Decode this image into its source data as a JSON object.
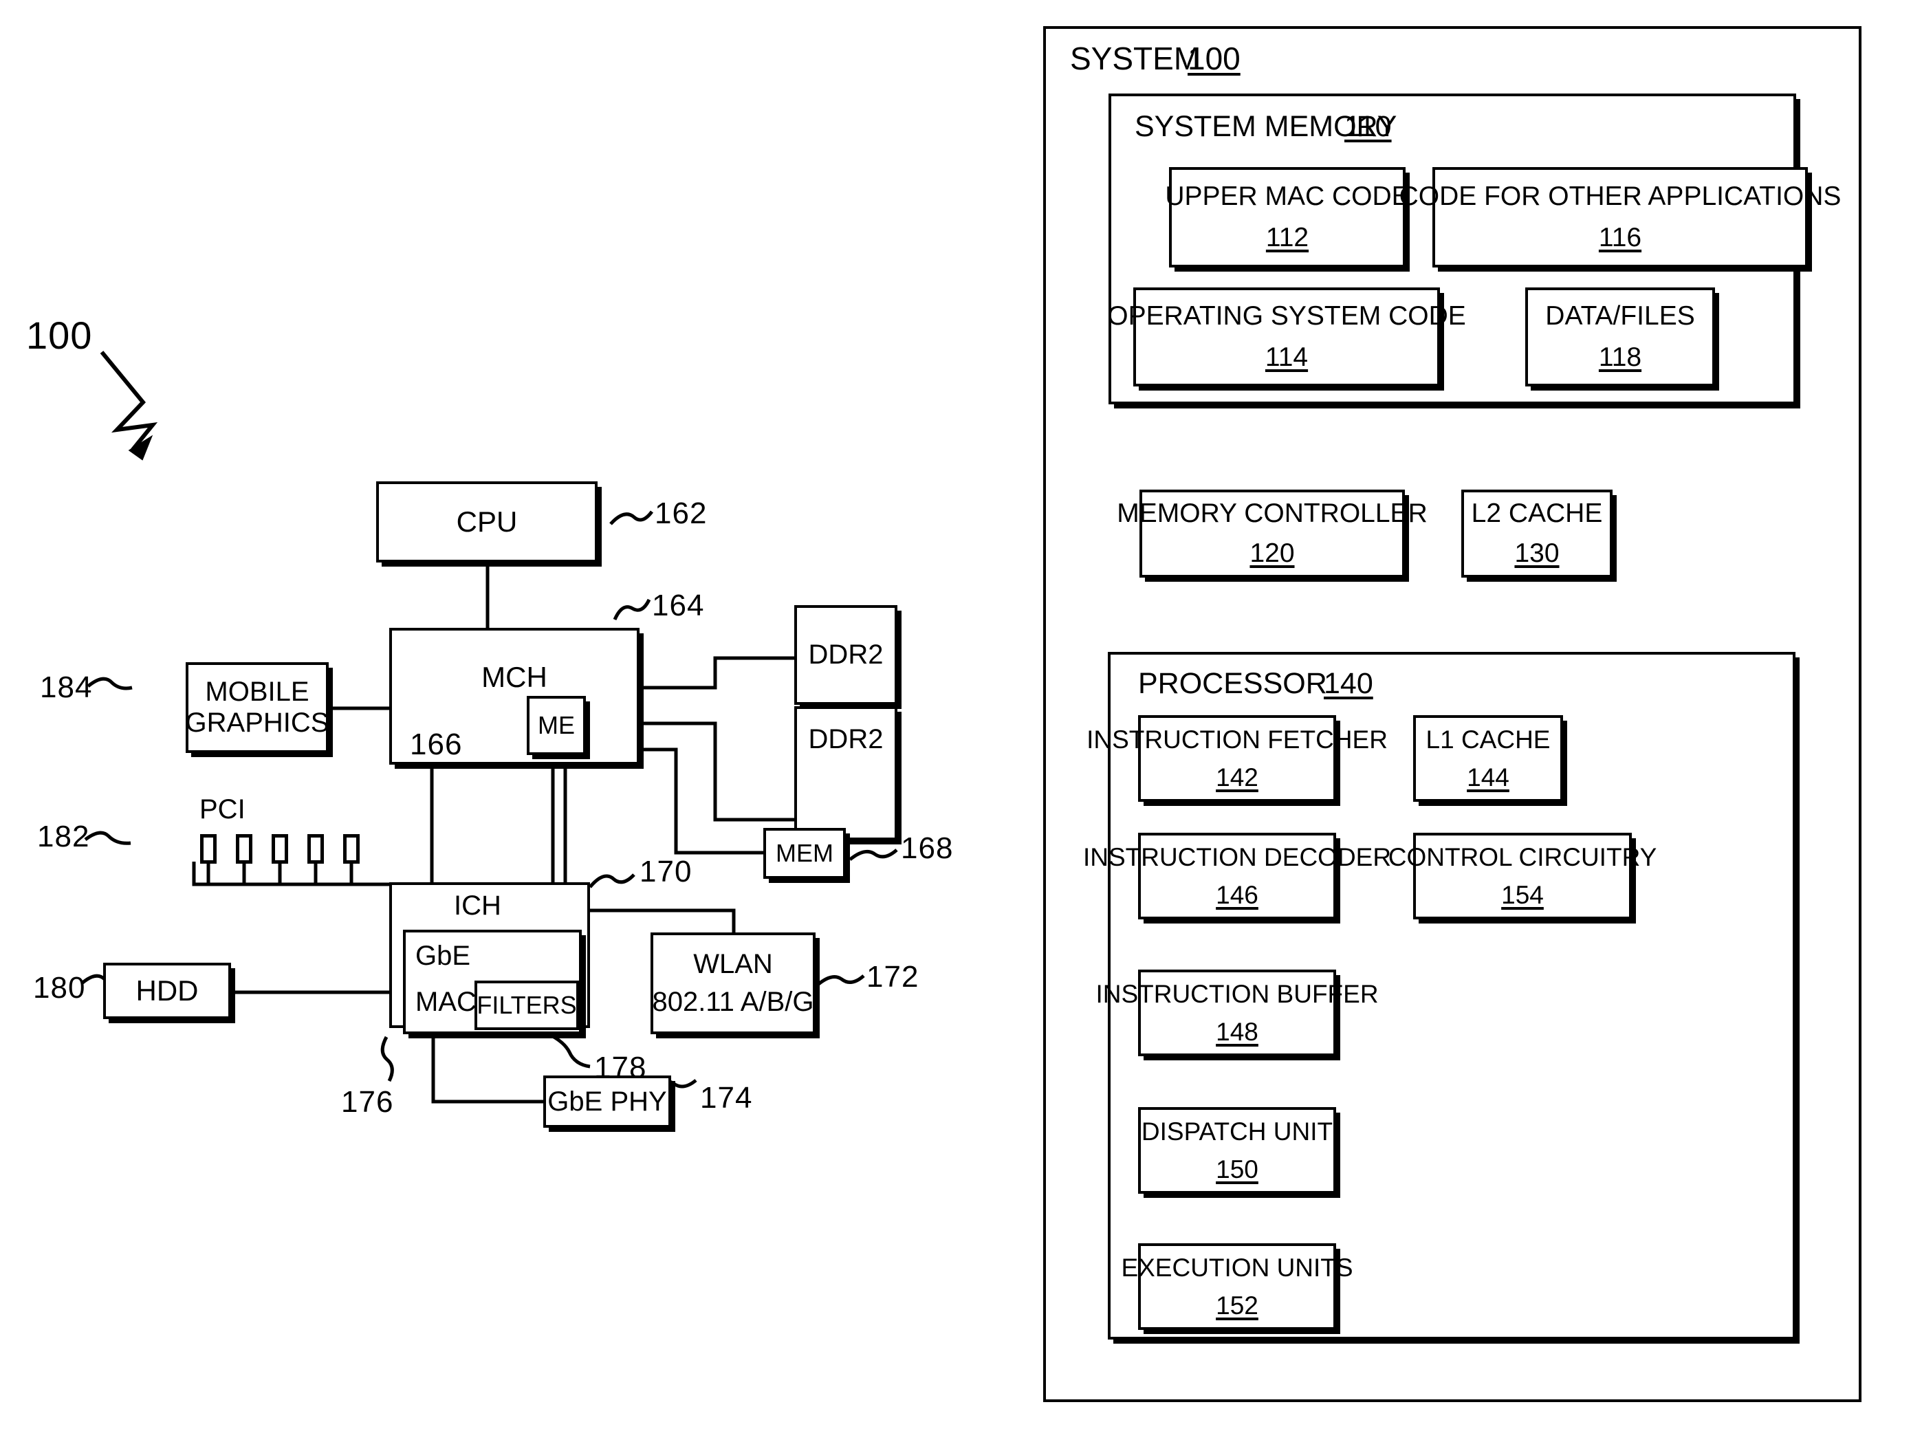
{
  "figure": {
    "left_diagram": {
      "ref_label": "100",
      "blocks": [
        {
          "id": "cpu",
          "label": "CPU",
          "ref": "162"
        },
        {
          "id": "mch",
          "label": "MCH",
          "ref": "164"
        },
        {
          "id": "me",
          "label": "ME",
          "ref": "166"
        },
        {
          "id": "ddr2_upper",
          "label": "DDR2",
          "ref": ""
        },
        {
          "id": "ddr2_lower",
          "label": "DDR2",
          "ref": ""
        },
        {
          "id": "mem",
          "label": "MEM",
          "ref": "168"
        },
        {
          "id": "ich",
          "label": "ICH",
          "ref": "170"
        },
        {
          "id": "wlan",
          "label_line1": "WLAN",
          "label_line2": "802.11 A/B/G",
          "ref": "172"
        },
        {
          "id": "gbe_phy",
          "label": "GbE PHY",
          "ref": "174"
        },
        {
          "id": "gbe_mac",
          "label_line1": "GbE",
          "label_line2": "MAC",
          "ref": "176"
        },
        {
          "id": "filters",
          "label": "FILTERS",
          "ref": "178"
        },
        {
          "id": "hdd",
          "label": "HDD",
          "ref": "180"
        },
        {
          "id": "pci",
          "label": "PCI",
          "ref": "182",
          "slot_count": 5
        },
        {
          "id": "mobile_graphics",
          "label_line1": "MOBILE",
          "label_line2": "GRAPHICS",
          "ref": "184"
        }
      ]
    },
    "right_diagram": {
      "system": {
        "title": "SYSTEM",
        "ref": "100"
      },
      "system_memory": {
        "title": "SYSTEM MEMORY",
        "ref": "110",
        "blocks": [
          {
            "id": "upper_mac_code",
            "label": "UPPER MAC CODE",
            "ref": "112"
          },
          {
            "id": "code_other_apps",
            "label": "CODE FOR OTHER APPLICATIONS",
            "ref": "116"
          },
          {
            "id": "os_code",
            "label": "OPERATING SYSTEM CODE",
            "ref": "114"
          },
          {
            "id": "data_files",
            "label": "DATA/FILES",
            "ref": "118"
          }
        ]
      },
      "mid_blocks": [
        {
          "id": "memory_controller",
          "label": "MEMORY CONTROLLER",
          "ref": "120"
        },
        {
          "id": "l2_cache",
          "label": "L2 CACHE",
          "ref": "130"
        }
      ],
      "processor": {
        "title": "PROCESSOR",
        "ref": "140",
        "blocks": [
          {
            "id": "instruction_fetcher",
            "label": "INSTRUCTION FETCHER",
            "ref": "142"
          },
          {
            "id": "l1_cache",
            "label": "L1 CACHE",
            "ref": "144"
          },
          {
            "id": "instruction_decoder",
            "label": "INSTRUCTION DECODER",
            "ref": "146"
          },
          {
            "id": "control_circuitry",
            "label": "CONTROL CIRCUITRY",
            "ref": "154"
          },
          {
            "id": "instruction_buffer",
            "label": "INSTRUCTION BUFFER",
            "ref": "148"
          },
          {
            "id": "dispatch_unit",
            "label": "DISPATCH UNIT",
            "ref": "150"
          },
          {
            "id": "execution_units",
            "label": "EXECUTION UNITS",
            "ref": "152"
          }
        ]
      }
    },
    "colors": {
      "ink": "#000000",
      "paper": "#ffffff"
    }
  }
}
